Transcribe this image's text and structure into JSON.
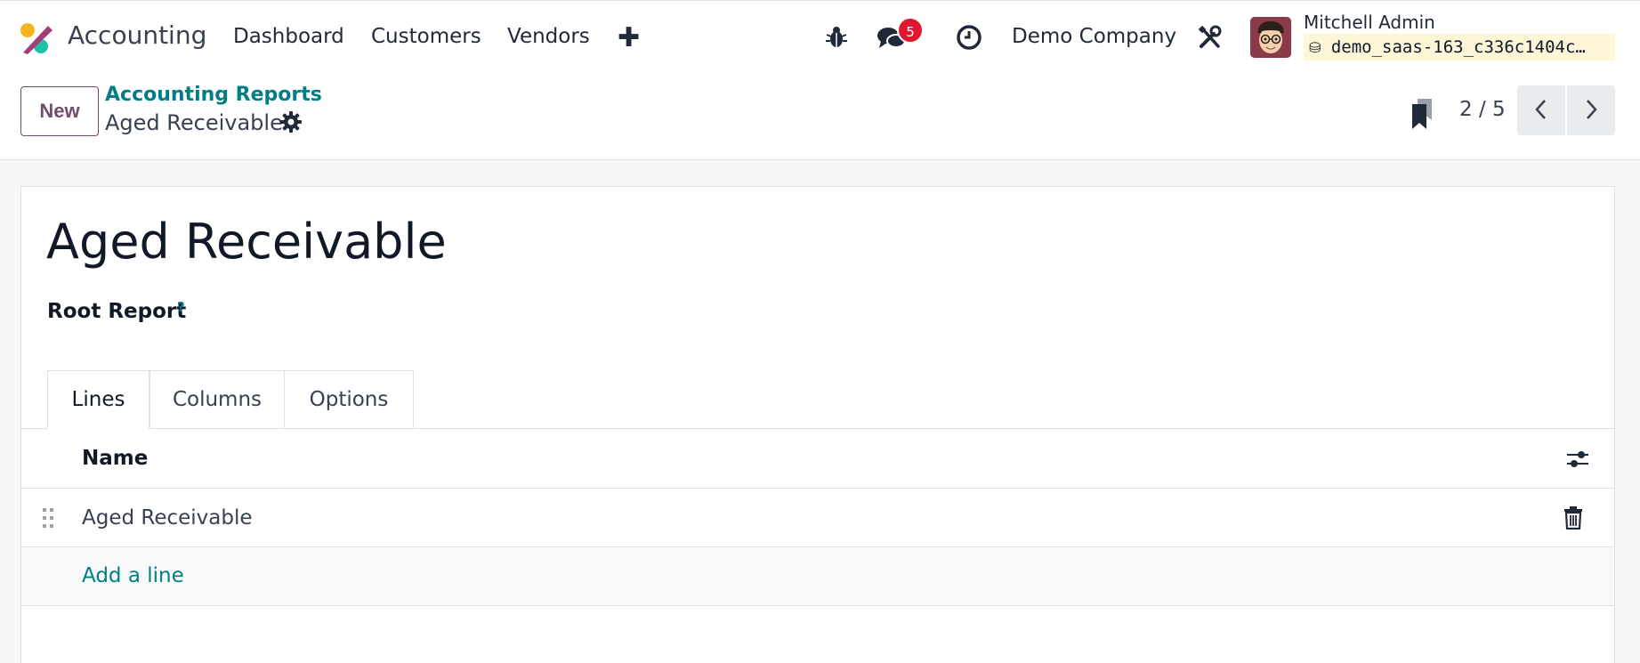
{
  "navbar": {
    "app_name": "Accounting",
    "menu": [
      "Dashboard",
      "Customers",
      "Vendors"
    ],
    "add_icon": "plus-icon",
    "debug_icon": "bug-icon",
    "messages_icon": "chat-icon",
    "messages_count": "5",
    "activity_icon": "clock-icon",
    "company": "Demo Company",
    "settings_icon": "tools-icon",
    "user_name": "Mitchell Admin",
    "database": "demo_saas-163_c336c1404c…"
  },
  "control": {
    "new_label": "New",
    "breadcrumb_parent": "Accounting Reports",
    "breadcrumb_current": "Aged Receivable",
    "pager": "2 / 5"
  },
  "form": {
    "title": "Aged Receivable",
    "field_label": "Root Report",
    "help_mark": "?",
    "tabs": [
      "Lines",
      "Columns",
      "Options"
    ],
    "active_tab": "Lines",
    "list": {
      "column_name": "Name",
      "rows": [
        {
          "name": "Aged Receivable"
        }
      ],
      "add_line": "Add a line"
    }
  },
  "colors": {
    "brand": "#714b67",
    "link": "#017e84",
    "badge": "#e0172f",
    "db_chip": "#fdf7d8"
  }
}
